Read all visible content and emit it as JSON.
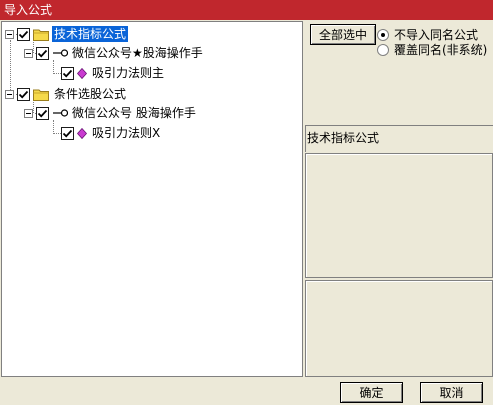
{
  "window": {
    "title": "导入公式"
  },
  "tree": {
    "groups": [
      {
        "label": "技术指标公式",
        "checked": true,
        "selected": true,
        "children": [
          {
            "label": "微信公众号★股海操作手",
            "checked": true,
            "children": [
              {
                "label": "吸引力法则主",
                "checked": true
              }
            ]
          }
        ]
      },
      {
        "label": "条件选股公式",
        "checked": true,
        "selected": false,
        "children": [
          {
            "label": "微信公众号 股海操作手",
            "checked": true,
            "children": [
              {
                "label": "吸引力法则X",
                "checked": true
              }
            ]
          }
        ]
      }
    ]
  },
  "options": {
    "select_all_label": "全部选中",
    "radios": [
      {
        "label": "不导入同名公式",
        "selected": true
      },
      {
        "label": "覆盖同名(非系统)",
        "selected": false
      }
    ]
  },
  "info": {
    "label": "技术指标公式"
  },
  "footer": {
    "ok_label": "确定",
    "cancel_label": "取消"
  },
  "icons": {
    "folder": "folder-icon",
    "key": "key-icon",
    "formula": "diamond-icon",
    "check": "checkmark-icon"
  },
  "colors": {
    "titlebar": "#c0272d",
    "selection": "#0a64d8",
    "folder": "#f5d94a",
    "formula": "#c93bd0"
  }
}
